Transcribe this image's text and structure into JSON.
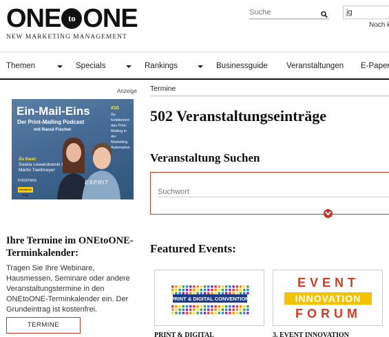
{
  "header": {
    "logo_left": "ONE",
    "logo_mid": "to",
    "logo_right": "ONE",
    "logo_tagline": "NEW MARKETING MANAGEMENT",
    "search_placeholder": "Suche",
    "login_value": "jg",
    "login_link": "Noch ke"
  },
  "nav": {
    "items": [
      {
        "label": "Themen"
      },
      {
        "label": "Specials"
      },
      {
        "label": "Rankings"
      },
      {
        "label": "Businessguide"
      },
      {
        "label": "Veranstaltungen"
      },
      {
        "label": "E-Paper"
      }
    ]
  },
  "sidebar": {
    "ad_label": "Anzeige",
    "podcast": {
      "title": "Ein-Mail-Eins",
      "subtitle": "Der Print-Mailing Podcast",
      "host": "mit Raoul Fischer",
      "episode": "#10",
      "description": "So funktioniert das Print-Mailing in der Marketing Automation",
      "guest_label": "Zu Gast:",
      "guest_names": "Saskia Lewandowski & Martin Twellmeyer",
      "brand": "PODSTARS",
      "post_logo": "Deutsche Post",
      "esprit": "ESPRIT"
    },
    "termine_title": "Ihre Termine im ONEtoONE-Terminkalender:",
    "termine_text": "Tragen Sie Ihre Webinare, Hausmessen, Seminare oder andere Veranstaltungstermine in den ONEtoONE-Terminkalender ein. Der Grundeintrag ist kostenfrei.",
    "termine_button": "TERMINE EINTRAGEN"
  },
  "main": {
    "breadcrumb": "Termine",
    "count_title": "502 Veranstaltungseinträge",
    "search_title": "Veranstaltung Suchen",
    "search_placeholder": "Suchwort",
    "featured_title": "Featured Events:",
    "events": [
      {
        "logo_text": "PRINT & DIGITAL CONVENTION",
        "name": "PRINT & DIGITAL"
      },
      {
        "logo_top": "EVENT",
        "logo_mid": "INNOVATION",
        "logo_bottom": "FORUM",
        "name": "3. EVENT INNOVATION"
      }
    ]
  },
  "colors": {
    "accent": "#c0392b",
    "text": "#111111",
    "podcast_bg": "#4a709a",
    "eif_red": "#d13b28",
    "eif_yellow": "#f3c300"
  }
}
